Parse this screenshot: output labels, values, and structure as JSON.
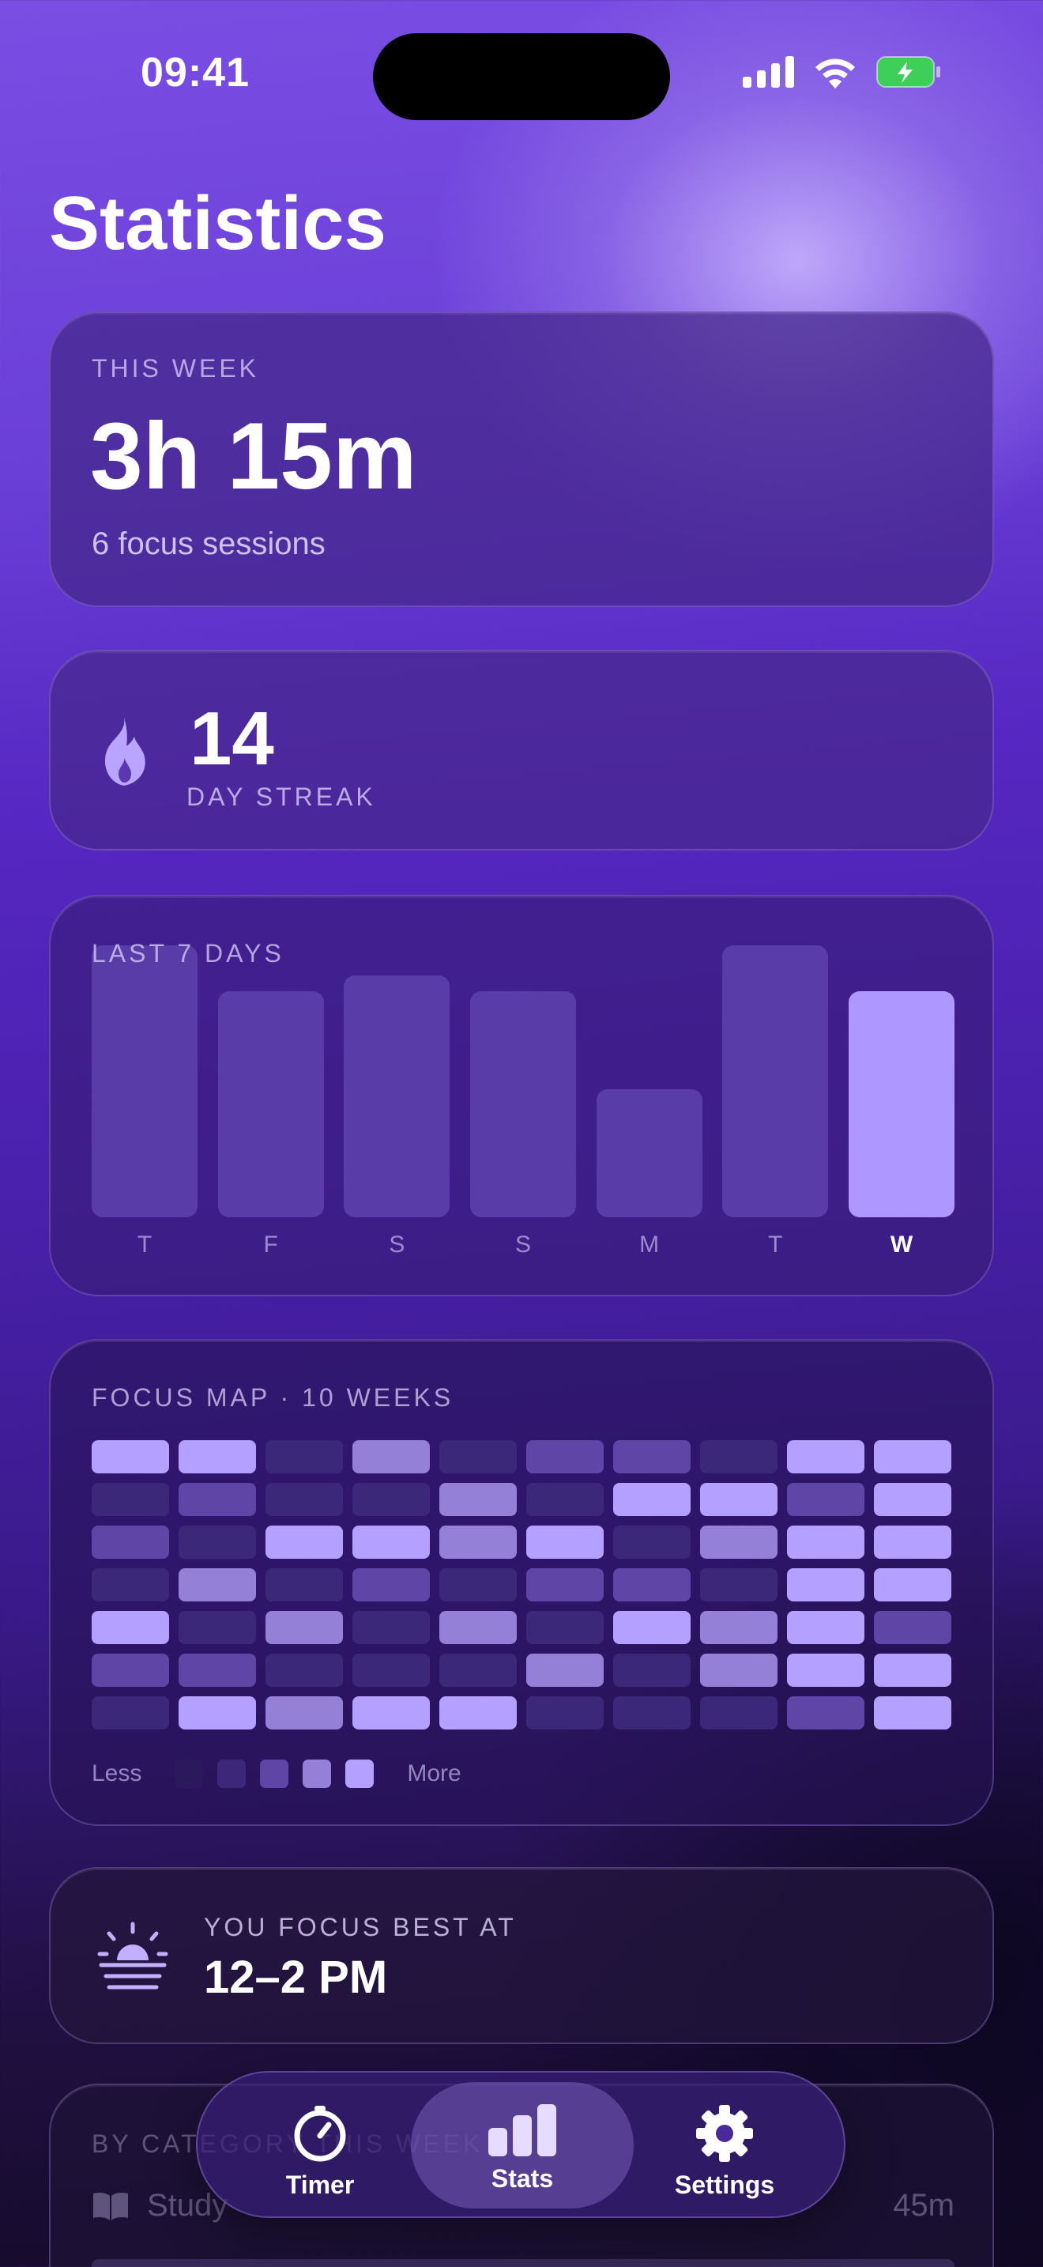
{
  "status_bar": {
    "time": "09:41"
  },
  "page_title": "Statistics",
  "this_week": {
    "label": "THIS WEEK",
    "total": "3h 15m",
    "sessions": "6 focus sessions"
  },
  "streak": {
    "value": "14",
    "label": "DAY STREAK",
    "icon": "flame-icon"
  },
  "last7": {
    "label": "LAST 7 DAYS",
    "chart_data": {
      "type": "bar",
      "categories": [
        "T",
        "F",
        "S",
        "S",
        "M",
        "T",
        "W"
      ],
      "values": [
        1.0,
        0.83,
        0.89,
        0.83,
        0.47,
        1.0,
        0.83
      ],
      "highlight_index": 6,
      "colors": {
        "bar": "#5a3ca8",
        "today": "#ae98ff"
      }
    }
  },
  "focus_map": {
    "label": "FOCUS MAP · 10 WEEKS",
    "levels": [
      [
        4,
        4,
        1,
        3,
        1,
        2,
        2,
        1,
        4,
        4
      ],
      [
        1,
        2,
        1,
        1,
        3,
        1,
        4,
        4,
        2,
        4
      ],
      [
        2,
        1,
        4,
        4,
        3,
        4,
        1,
        3,
        4,
        4
      ],
      [
        1,
        3,
        1,
        2,
        1,
        2,
        2,
        1,
        4,
        4
      ],
      [
        4,
        1,
        3,
        1,
        3,
        1,
        4,
        3,
        4,
        2
      ],
      [
        2,
        2,
        1,
        1,
        1,
        3,
        1,
        3,
        4,
        4
      ],
      [
        1,
        4,
        3,
        4,
        4,
        1,
        1,
        1,
        2,
        4
      ]
    ],
    "palette": [
      "#2a1a5c",
      "#3c2878",
      "#5e45a6",
      "#9480d6",
      "#b3a0ff"
    ],
    "legend_less": "Less",
    "legend_more": "More"
  },
  "best_time": {
    "label": "YOU FOCUS BEST AT",
    "value": "12–2 PM",
    "icon": "sunrise-icon"
  },
  "category": {
    "label": "BY CATEGORY THIS WEEK",
    "rows": [
      {
        "name": "Study",
        "duration": "45m",
        "icon": "book-icon"
      }
    ]
  },
  "tab_bar": {
    "tabs": [
      {
        "label": "Timer",
        "icon": "timer-icon",
        "active": false
      },
      {
        "label": "Stats",
        "icon": "stats-icon",
        "active": true
      },
      {
        "label": "Settings",
        "icon": "gear-icon",
        "active": false
      }
    ]
  }
}
